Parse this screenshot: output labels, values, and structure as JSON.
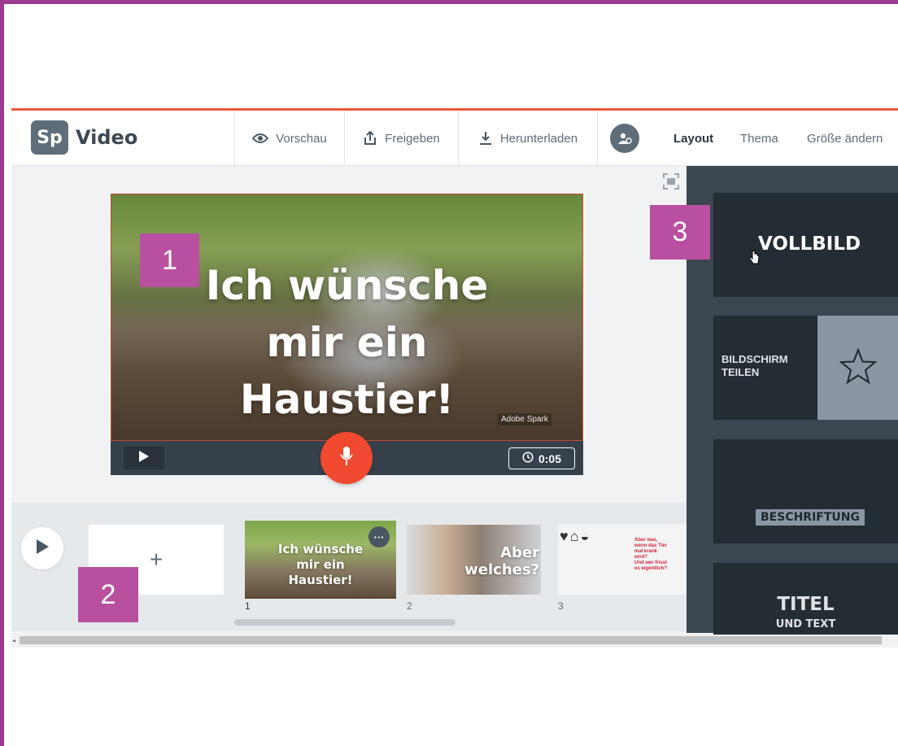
{
  "app": {
    "logo_badge": "Sp",
    "logo_text": "Video"
  },
  "header": {
    "preview_label": "Vorschau",
    "share_label": "Freigeben",
    "download_label": "Herunterladen",
    "tabs": [
      {
        "label": "Layout",
        "active": true
      },
      {
        "label": "Thema",
        "active": false
      },
      {
        "label": "Größe ändern",
        "active": false
      }
    ]
  },
  "slide": {
    "title": "Ich wünsche\nmir ein\nHaustier!",
    "watermark": "Adobe Spark",
    "duration": "0:05"
  },
  "timeline": {
    "add_label": "+",
    "thumbnails": [
      {
        "number": "1",
        "text": "Ich wünsche\nmir ein\nHaustier!",
        "more": "···"
      },
      {
        "number": "2",
        "text": "Aber\nwelches?"
      },
      {
        "number": "3",
        "text": "Aber was,\nwenn das Tier\nmal krank\nwird?\nUnd wer frisst\nes eigentlich?"
      }
    ]
  },
  "layouts": {
    "fullscreen": "VOLLBILD",
    "split": "BILDSCHIRM\nTEILEN",
    "caption": "BESCHRIFTUNG",
    "title": "TITEL",
    "title_sub": "UND TEXT"
  },
  "callouts": {
    "one": "1",
    "two": "2",
    "three": "3"
  },
  "colors": {
    "accent": "#ee5a3c",
    "mic": "#f0492f",
    "callout": "#b8509f",
    "panel": "#3b4650"
  }
}
